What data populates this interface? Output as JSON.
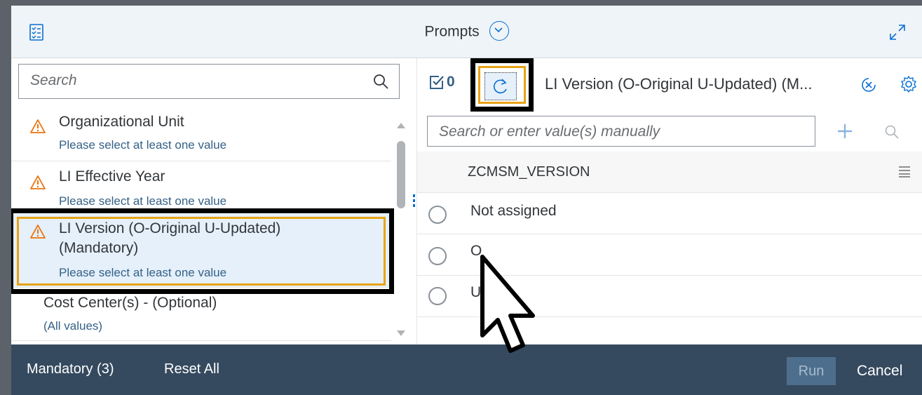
{
  "header": {
    "title": "Prompts",
    "left_icon": "checklist-icon",
    "expand_icon": "fullscreen-icon",
    "title_menu_icon": "chevron-down-circle-icon"
  },
  "left_panel": {
    "search_placeholder": "Search",
    "items": [
      {
        "title": "Organizational Unit",
        "subtitle": "Please select at least one value",
        "icon": "warning-icon"
      },
      {
        "title": "LI Effective Year",
        "subtitle": "Please select at least one value",
        "icon": "warning-icon"
      },
      {
        "title_line1": "LI Version (O-Original U-Updated)",
        "title_line2": "(Mandatory)",
        "subtitle": "Please select at least one value",
        "icon": "warning-icon",
        "selected": true
      },
      {
        "title": "Cost Center(s) - (Optional)",
        "subtitle": "(All values)"
      }
    ]
  },
  "right_panel": {
    "selected_count": "0",
    "title": "LI Version (O-Original U-Updated) (M...",
    "value_placeholder": "Search or enter value(s) manually",
    "column_header": "ZCMSM_VERSION",
    "rows": [
      "Not assigned",
      "O",
      "U"
    ]
  },
  "footer": {
    "mandatory_label": "Mandatory (3)",
    "reset_label": "Reset All",
    "run_label": "Run",
    "cancel_label": "Cancel"
  },
  "colors": {
    "accent": "#0a6ed1",
    "warning": "#e9730c",
    "highlight": "#e8a317",
    "footer": "#354a5f"
  }
}
